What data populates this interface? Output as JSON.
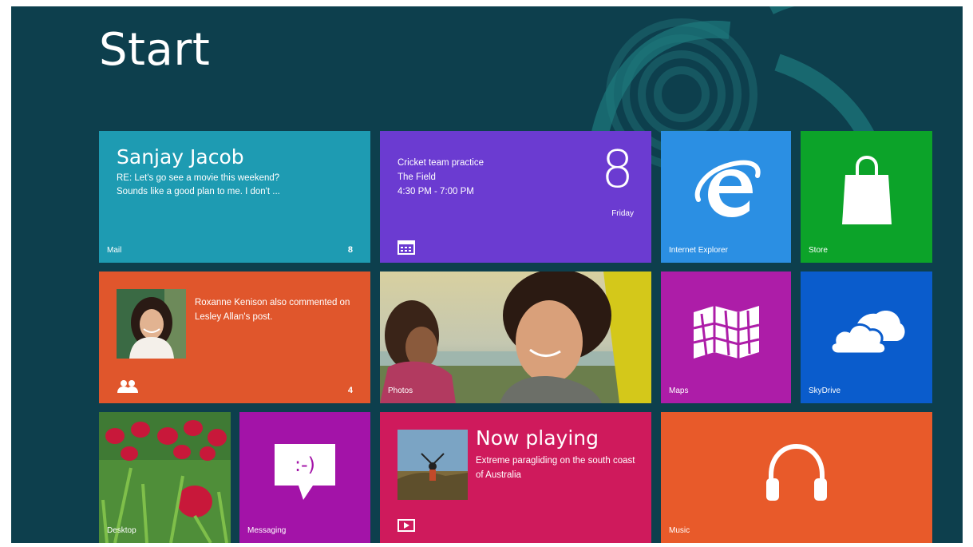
{
  "start_title": "Start",
  "tiles": {
    "mail": {
      "sender": "Sanjay Jacob",
      "subject": "RE: Let's go see a movie this weekend?",
      "preview": "Sounds like a good plan to me. I don't ...",
      "label": "Mail",
      "count": "8",
      "color": "#1e9bb2"
    },
    "calendar": {
      "event": "Cricket team practice",
      "location": "The Field",
      "time": "4:30 PM - 7:00 PM",
      "day": "8",
      "weekday": "Friday",
      "color": "#6b3bd1"
    },
    "internet_explorer": {
      "label": "Internet Explorer",
      "icon": "internet-explorer-icon",
      "color": "#2b8fe3"
    },
    "store": {
      "label": "Store",
      "icon": "shopping-bag-icon",
      "color": "#0ca329"
    },
    "people": {
      "text": "Roxanne Kenison also commented on Lesley Allan's post.",
      "count": "4",
      "icon": "people-icon",
      "color": "#e0562c"
    },
    "photos": {
      "label": "Photos"
    },
    "maps": {
      "label": "Maps",
      "icon": "map-icon",
      "color": "#ad1da8"
    },
    "skydrive": {
      "label": "SkyDrive",
      "icon": "cloud-icon",
      "color": "#0a5ccc"
    },
    "desktop": {
      "label": "Desktop"
    },
    "messaging": {
      "label": "Messaging",
      "icon": "speech-bubble-icon",
      "emoticon": ":-)",
      "color": "#a313a8"
    },
    "video": {
      "title": "Now playing",
      "description": "Extreme paragliding on the south coast of Australia",
      "icon": "play-icon",
      "color": "#cf1a5c"
    },
    "music": {
      "label": "Music",
      "icon": "headphones-icon",
      "color": "#e85a2a"
    }
  }
}
